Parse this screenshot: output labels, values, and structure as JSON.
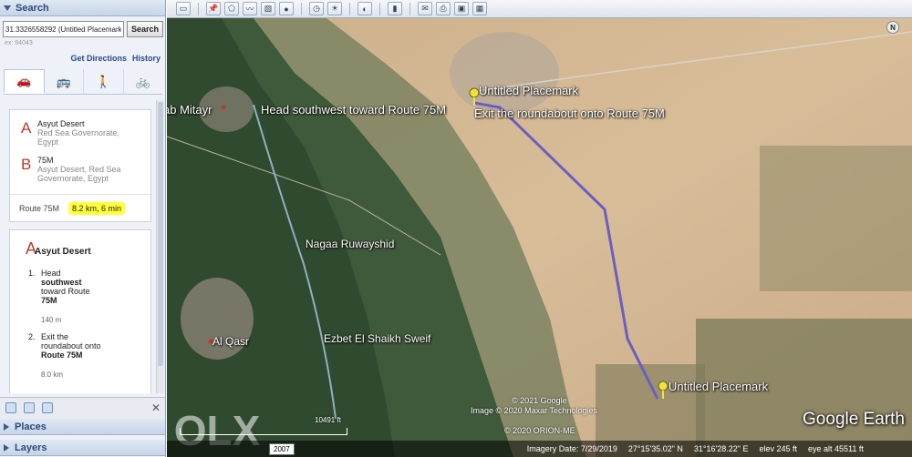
{
  "search": {
    "title": "Search",
    "query": "31.3326558292 (Untitled Placemark)",
    "button": "Search",
    "hint": "ex: 94043",
    "get_directions": "Get Directions",
    "history": "History"
  },
  "modes": [
    {
      "icon": "car-icon",
      "glyph": "🚗"
    },
    {
      "icon": "bus-icon",
      "glyph": "🚌"
    },
    {
      "icon": "walk-icon",
      "glyph": "🚶"
    },
    {
      "icon": "bike-icon",
      "glyph": "🚲"
    }
  ],
  "route": {
    "a_letter": "A",
    "a_name": "Asyut Desert",
    "a_sub": "Red Sea Governorate, Egypt",
    "b_letter": "B",
    "b_name": "75M",
    "b_sub": "Asyut Desert, Red Sea Governorate, Egypt",
    "road": "Route 75M",
    "summary": "8.2 km, 6 min"
  },
  "steps": {
    "start_letter": "A",
    "start_name": "Asyut Desert",
    "items": [
      {
        "num": "1.",
        "line1": "Head",
        "line2": "southwest",
        "line3": "toward Route",
        "line4": "75M",
        "dist": "140 m"
      },
      {
        "num": "2.",
        "line1": "Exit the",
        "line2": "roundabout onto",
        "line3": "Route 75M",
        "dist": "8.0 km"
      }
    ]
  },
  "panels": {
    "places": "Places",
    "layers": "Layers"
  },
  "map": {
    "labels": {
      "mitayr": "ab Mitayr",
      "head": "Head southwest toward Route 75M",
      "pm1": "Untitled Placemark",
      "exit": "Exit the roundabout onto Route 75M",
      "nagaa": "Nagaa Ruwayshid",
      "qasr": "Al Qasr",
      "ezbet": "Ezbet El Shaikh Sweif",
      "pm2": "Untitled Placemark"
    },
    "copyright": [
      "© 2021 Google",
      "Image © 2020 Maxar Technologies",
      "© 2020 ORION-ME"
    ],
    "brand": "Google Earth",
    "scale": "10491 ft",
    "compass": "N",
    "route_color": "#6a5fc1",
    "status": {
      "year": "2007",
      "imagery": "Imagery Date: 7/29/2019",
      "lat": "27°15'35.02\" N",
      "lon": "31°16'28.22\" E",
      "elev": "elev  245 ft",
      "eye": "eye alt  45511 ft"
    }
  },
  "watermark": "OLX"
}
